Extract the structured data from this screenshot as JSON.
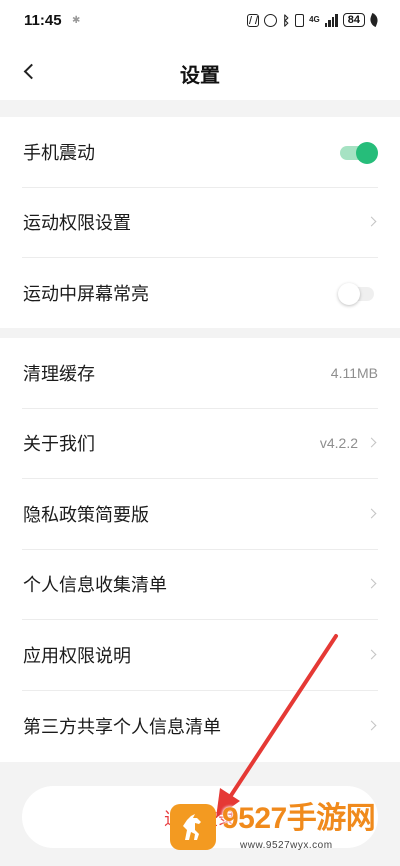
{
  "status_bar": {
    "time": "11:45",
    "signal_type": "4G",
    "battery": "84"
  },
  "header": {
    "title": "设置"
  },
  "groups": [
    {
      "items": [
        {
          "label": "手机震动",
          "control": "toggle",
          "state": "on"
        },
        {
          "label": "运动权限设置",
          "control": "arrow"
        },
        {
          "label": "运动中屏幕常亮",
          "control": "toggle",
          "state": "off"
        }
      ]
    },
    {
      "items": [
        {
          "label": "清理缓存",
          "value": "4.11MB",
          "control": "value"
        },
        {
          "label": "关于我们",
          "value": "v4.2.2",
          "control": "arrow"
        },
        {
          "label": "隐私政策简要版",
          "control": "arrow"
        },
        {
          "label": "个人信息收集清单",
          "control": "arrow"
        },
        {
          "label": "应用权限说明",
          "control": "arrow"
        },
        {
          "label": "第三方共享个人信息清单",
          "control": "arrow"
        }
      ]
    }
  ],
  "logout": {
    "label": "退出登录"
  },
  "watermark": {
    "text": "9527手游网",
    "url": "www.9527wyx.com"
  },
  "colors": {
    "accent_green": "#26bd7a",
    "logout_red": "#e8393d",
    "annotation_red": "#e53935",
    "watermark_orange": "#f08a1c"
  }
}
